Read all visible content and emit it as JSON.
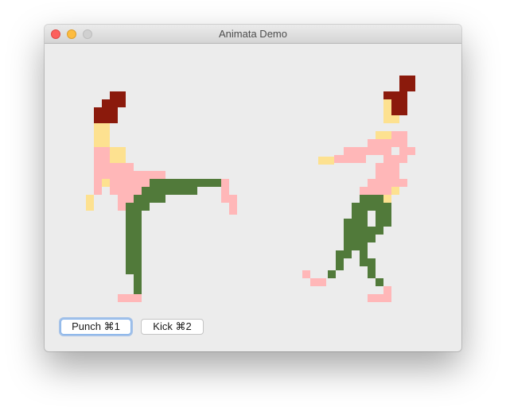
{
  "window": {
    "title": "Animata Demo",
    "controls": [
      "close",
      "minimize",
      "zoom"
    ]
  },
  "colors": {
    "hair": "#8b1a0c",
    "skin": "#fde190",
    "shirt": "#ffb7b8",
    "pants": "#517a3a",
    "window_bg": "#ececec",
    "default_button_ring": "#86b4ec"
  },
  "buttons": {
    "punch_label": "Punch ⌘1",
    "kick_label": "Kick ⌘2"
  }
}
